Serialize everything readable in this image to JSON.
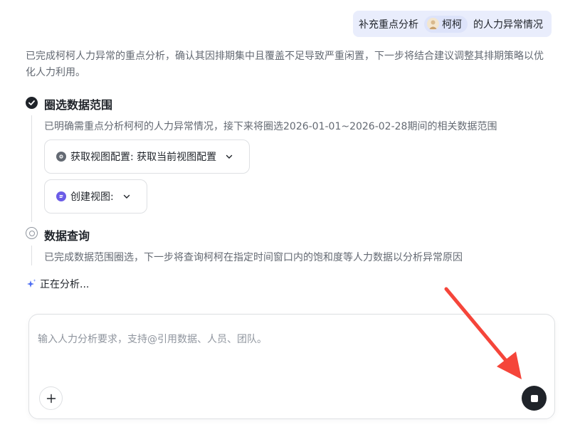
{
  "user_message": {
    "prefix": "补充重点分析",
    "mention_name": "柯柯",
    "suffix": "的人力异常情况"
  },
  "assistant": {
    "summary": "已完成柯柯人力异常的重点分析，确认其因排期集中且覆盖不足导致严重闲置，下一步将结合建议调整其排期策略以优化人力利用。",
    "steps": [
      {
        "title": "圈选数据范围",
        "status": "done",
        "description": "已明确需重点分析柯柯的人力异常情况，接下来将圈选2026-01-01~2026-02-28期间的相关数据范围",
        "tools": [
          {
            "label": "获取视图配置: 获取当前视图配置",
            "icon": "view-config-icon"
          },
          {
            "label": "创建视图:",
            "icon": "create-view-icon"
          }
        ]
      },
      {
        "title": "数据查询",
        "status": "pending",
        "description": "已完成数据范围圈选，下一步将查询柯柯在指定时间窗口内的饱和度等人力数据以分析异常原因"
      }
    ],
    "analyzing_text": "正在分析..."
  },
  "composer": {
    "placeholder": "输入人力分析要求，支持@引用数据、人员、团队。",
    "value": ""
  },
  "colors": {
    "accent": "#e9edfc",
    "annotation_arrow": "#f5453a",
    "sparkle": "#4e6ef2",
    "stop_button": "#1f2329"
  }
}
